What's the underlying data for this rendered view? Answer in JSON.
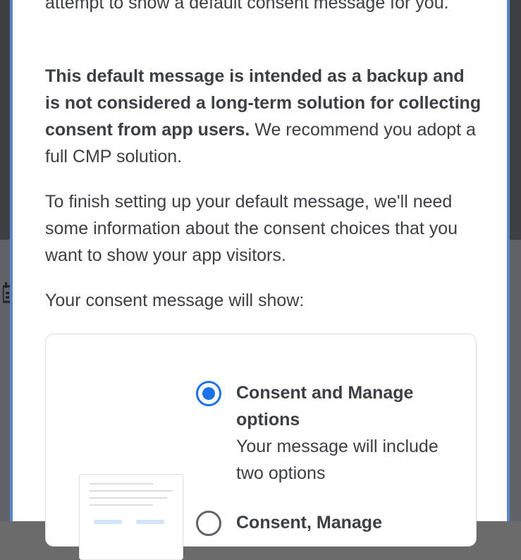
{
  "dialog": {
    "paragraphs": {
      "intro_end": "attempt to show a default consent message for you.",
      "backup_bold": "This default message is intended as a backup and is not considered a long-term solution for collecting consent from app users.",
      "backup_rest": " We recommend you adopt a full CMP solution.",
      "finish_setup": "To finish setting up your default message, we'll need some information about the consent choices that you want to show your app visitors.",
      "will_show": "Your consent message will show:"
    },
    "options": [
      {
        "title": "Consent and Manage options",
        "description": "Your message will include two options",
        "selected": true
      },
      {
        "title": "Consent, Manage",
        "selected": false
      }
    ]
  },
  "background": {
    "left_icon": "calendar-icon"
  },
  "colors": {
    "accent": "#1a73e8",
    "text": "#3c4043",
    "border": "#dadce0"
  }
}
